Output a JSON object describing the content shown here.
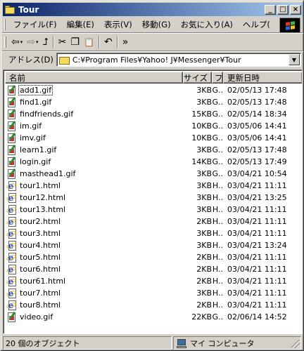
{
  "window": {
    "title": "Tour"
  },
  "title_buttons": {
    "minimize": "_",
    "maximize": "□",
    "close": "×"
  },
  "menu": [
    {
      "label": "ファイル(F)"
    },
    {
      "label": "編集(E)"
    },
    {
      "label": "表示(V)"
    },
    {
      "label": "移動(G)"
    },
    {
      "label": "お気に入り(A)"
    },
    {
      "label": "ヘルプ("
    }
  ],
  "menu_overflow": "»",
  "toolbar": {
    "back_icon": "⇦",
    "forward_icon": "⇨",
    "drop": "▾",
    "up_icon": "⮥",
    "cut_icon": "✂",
    "copy_icon": "❐",
    "paste_icon": "📋",
    "undo_icon": "↶",
    "overflow": "»"
  },
  "address": {
    "label": "アドレス(D)",
    "path": "C:¥Program Files¥Yahoo! J¥Messenger¥Tour",
    "drop": "▼"
  },
  "columns": {
    "name": "名前",
    "size": "サイズ",
    "type": "フ",
    "date": "更新日時"
  },
  "files": [
    {
      "name": "add1.gif",
      "size": "3KB",
      "type": "G..",
      "date": "02/05/13 17:48",
      "icon": "gif"
    },
    {
      "name": "find1.gif",
      "size": "3KB",
      "type": "G..",
      "date": "02/05/13 17:48",
      "icon": "gif"
    },
    {
      "name": "findfriends.gif",
      "size": "15KB",
      "type": "G..",
      "date": "02/05/14 18:34",
      "icon": "gif"
    },
    {
      "name": "im.gif",
      "size": "10KB",
      "type": "G..",
      "date": "03/05/06 14:41",
      "icon": "gif"
    },
    {
      "name": "imv.gif",
      "size": "10KB",
      "type": "G..",
      "date": "03/05/06 14:41",
      "icon": "gif"
    },
    {
      "name": "learn1.gif",
      "size": "3KB",
      "type": "G..",
      "date": "02/05/13 17:48",
      "icon": "gif"
    },
    {
      "name": "login.gif",
      "size": "14KB",
      "type": "G..",
      "date": "02/05/13 17:49",
      "icon": "gif"
    },
    {
      "name": "masthead1.gif",
      "size": "3KB",
      "type": "G..",
      "date": "03/04/21 10:54",
      "icon": "gif"
    },
    {
      "name": "tour1.html",
      "size": "3KB",
      "type": "H..",
      "date": "03/04/21 11:11",
      "icon": "html"
    },
    {
      "name": "tour12.html",
      "size": "3KB",
      "type": "H..",
      "date": "03/04/21 13:25",
      "icon": "html"
    },
    {
      "name": "tour13.html",
      "size": "3KB",
      "type": "H..",
      "date": "03/04/21 11:11",
      "icon": "html"
    },
    {
      "name": "tour2.html",
      "size": "2KB",
      "type": "H..",
      "date": "03/04/21 11:11",
      "icon": "html"
    },
    {
      "name": "tour3.html",
      "size": "3KB",
      "type": "H..",
      "date": "03/04/21 11:11",
      "icon": "html"
    },
    {
      "name": "tour4.html",
      "size": "3KB",
      "type": "H..",
      "date": "03/04/21 13:24",
      "icon": "html"
    },
    {
      "name": "tour5.html",
      "size": "2KB",
      "type": "H..",
      "date": "03/04/21 11:11",
      "icon": "html"
    },
    {
      "name": "tour6.html",
      "size": "2KB",
      "type": "H..",
      "date": "03/04/21 11:11",
      "icon": "html"
    },
    {
      "name": "tour61.html",
      "size": "2KB",
      "type": "H..",
      "date": "03/04/21 11:11",
      "icon": "html"
    },
    {
      "name": "tour7.html",
      "size": "3KB",
      "type": "H..",
      "date": "03/04/21 11:11",
      "icon": "html"
    },
    {
      "name": "tour8.html",
      "size": "2KB",
      "type": "H..",
      "date": "03/04/21 11:11",
      "icon": "html"
    },
    {
      "name": "video.gif",
      "size": "22KB",
      "type": "G..",
      "date": "02/06/14 14:52",
      "icon": "gif"
    }
  ],
  "focused_index": 0,
  "status": {
    "count": "20 個のオブジェクト",
    "location": "マイ コンピュータ"
  }
}
